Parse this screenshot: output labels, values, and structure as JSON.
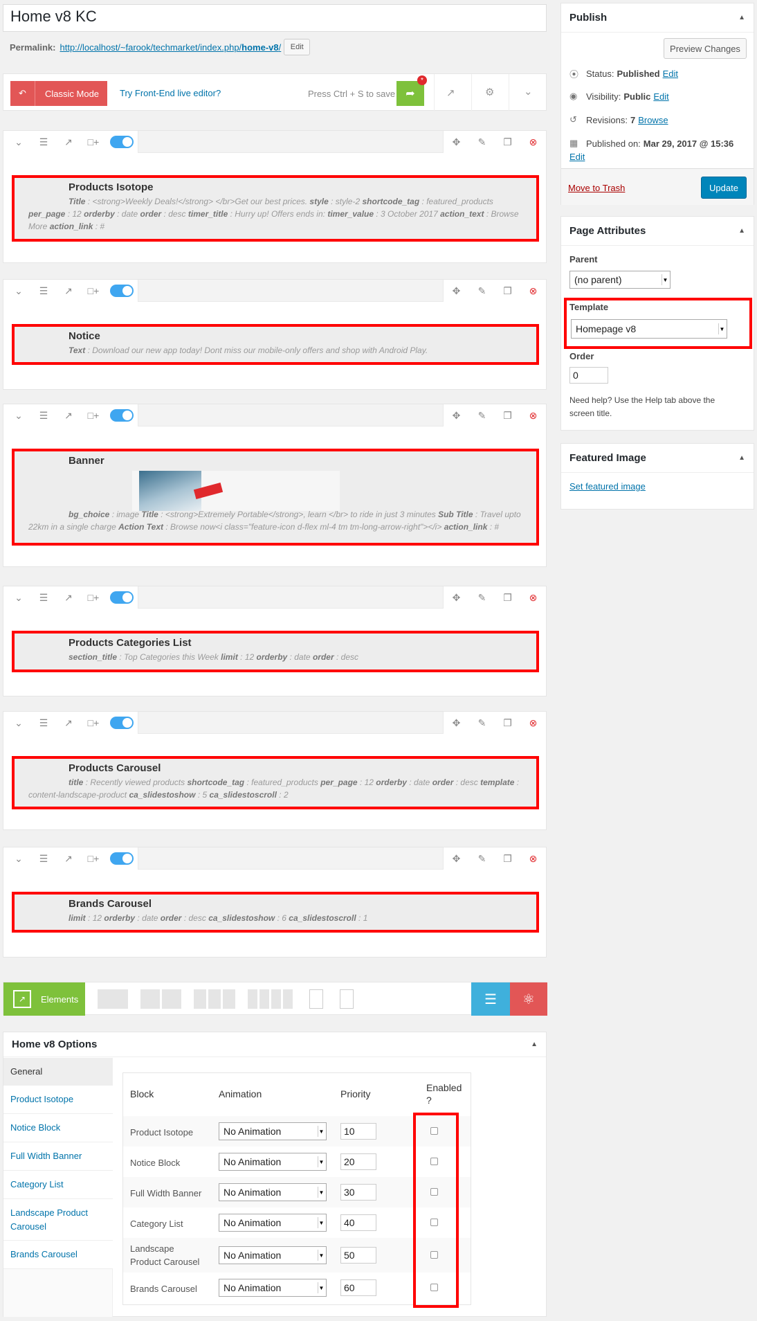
{
  "page": {
    "title": "Home v8 KC",
    "permalink_label": "Permalink:",
    "permalink_url": "http://localhost/~farook/techmarket/index.php/",
    "permalink_slug": "home-v8",
    "permalink_suffix": "/",
    "edit_label": "Edit"
  },
  "toolbar": {
    "classic_mode": "Classic Mode",
    "front_end_link": "Try Front-End live editor?",
    "save_hint": "Press Ctrl + S to save",
    "badge": "*"
  },
  "rows": [
    {
      "name": "Products Isotope",
      "params": [
        {
          "k": "Title",
          "v": "<strong>Weekly Deals!</strong> </br>Get our best prices."
        },
        {
          "k": "style",
          "v": "style-2"
        },
        {
          "k": "shortcode_tag",
          "v": "featured_products"
        },
        {
          "k": "per_page",
          "v": "12"
        },
        {
          "k": "orderby",
          "v": "date"
        },
        {
          "k": "order",
          "v": "desc"
        },
        {
          "k": "timer_title",
          "v": "Hurry up! Offers ends in:"
        },
        {
          "k": "timer_value",
          "v": "3 October 2017"
        },
        {
          "k": "action_text",
          "v": "Browse More"
        },
        {
          "k": "action_link",
          "v": "#"
        }
      ]
    },
    {
      "name": "Notice",
      "params": [
        {
          "k": "Text",
          "v": "Download our new app today! Dont miss our mobile-only offers and shop with Android Play."
        }
      ]
    },
    {
      "name": "Banner",
      "params": [
        {
          "k": "bg_choice",
          "v": "image"
        },
        {
          "k": "Title",
          "v": "<strong>Extremely Portable</strong>, learn </br> to ride in just 3 minutes"
        },
        {
          "k": "Sub Title",
          "v": "Travel upto 22km in a single charge"
        },
        {
          "k": "Action Text",
          "v": "Browse now<i class=\"feature-icon d-flex ml-4 tm tm-long-arrow-right\"></i>"
        },
        {
          "k": "action_link",
          "v": "#"
        }
      ]
    },
    {
      "name": "Products Categories List",
      "params": [
        {
          "k": "section_title",
          "v": "Top Categories this Week"
        },
        {
          "k": "limit",
          "v": "12"
        },
        {
          "k": "orderby",
          "v": "date"
        },
        {
          "k": "order",
          "v": "desc"
        }
      ]
    },
    {
      "name": "Products Carousel",
      "params": [
        {
          "k": "title",
          "v": "Recently viewed products"
        },
        {
          "k": "shortcode_tag",
          "v": "featured_products"
        },
        {
          "k": "per_page",
          "v": "12"
        },
        {
          "k": "orderby",
          "v": "date"
        },
        {
          "k": "order",
          "v": "desc"
        },
        {
          "k": "template",
          "v": "content-landscape-product"
        },
        {
          "k": "ca_slidestoshow",
          "v": "5"
        },
        {
          "k": "ca_slidestoscroll",
          "v": "2"
        }
      ]
    },
    {
      "name": "Brands Carousel",
      "params": [
        {
          "k": "limit",
          "v": "12"
        },
        {
          "k": "orderby",
          "v": "date"
        },
        {
          "k": "order",
          "v": "desc"
        },
        {
          "k": "ca_slidestoshow",
          "v": "6"
        },
        {
          "k": "ca_slidestoscroll",
          "v": "1"
        }
      ]
    }
  ],
  "bottombar": {
    "elements_label": "Elements"
  },
  "publish": {
    "title": "Publish",
    "preview_label": "Preview Changes",
    "status_label": "Status:",
    "status_value": "Published",
    "visibility_label": "Visibility:",
    "visibility_value": "Public",
    "revisions_label": "Revisions:",
    "revisions_value": "7",
    "browse_label": "Browse",
    "published_on_label": "Published on:",
    "published_on_value": "Mar 29, 2017 @ 15:36",
    "edit_label": "Edit",
    "trash_label": "Move to Trash",
    "update_label": "Update"
  },
  "page_attributes": {
    "title": "Page Attributes",
    "parent_label": "Parent",
    "parent_value": "(no parent)",
    "template_label": "Template",
    "template_value": "Homepage v8",
    "order_label": "Order",
    "order_value": "0",
    "help_text": "Need help? Use the Help tab above the screen title."
  },
  "featured_image": {
    "title": "Featured Image",
    "set_label": "Set featured image"
  },
  "options": {
    "title": "Home v8 Options",
    "tabs": [
      "General",
      "Product Isotope",
      "Notice Block",
      "Full Width Banner",
      "Category List",
      "Landscape Product Carousel",
      "Brands Carousel"
    ],
    "headers": {
      "block": "Block",
      "animation": "Animation",
      "priority": "Priority",
      "enabled": "Enabled ?"
    },
    "rows": [
      {
        "block": "Product Isotope",
        "animation": "No Animation",
        "priority": "10"
      },
      {
        "block": "Notice Block",
        "animation": "No Animation",
        "priority": "20"
      },
      {
        "block": "Full Width Banner",
        "animation": "No Animation",
        "priority": "30"
      },
      {
        "block": "Category List",
        "animation": "No Animation",
        "priority": "40"
      },
      {
        "block": "Landscape Product Carousel",
        "animation": "No Animation",
        "priority": "50"
      },
      {
        "block": "Brands Carousel",
        "animation": "No Animation",
        "priority": "60"
      }
    ]
  },
  "colors": {
    "highlight": "#ff0000",
    "classic": "#e25656",
    "green": "#7ec13b",
    "blue": "#0085ba",
    "toggle": "#3fa6f0"
  }
}
